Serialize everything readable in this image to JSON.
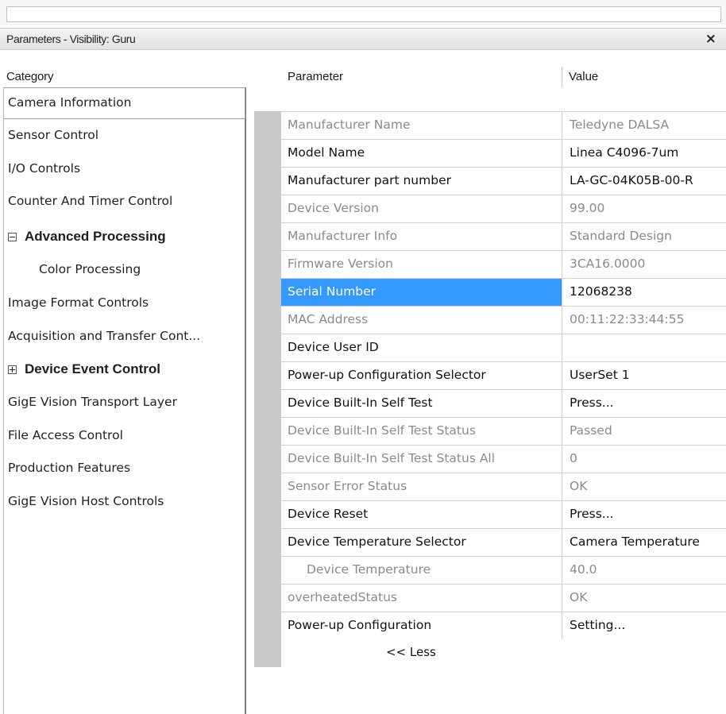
{
  "window": {
    "title": "Parameters - Visibility: Guru",
    "close_glyph": "×"
  },
  "header": {
    "category": "Category",
    "parameter": "Parameter",
    "value": "Value"
  },
  "categories": [
    {
      "label": "Camera Information",
      "selected": true
    },
    {
      "label": "Sensor Control"
    },
    {
      "label": "I/O Controls"
    },
    {
      "label": "Counter And Timer Control"
    },
    {
      "label": "Advanced Processing",
      "expander": "minus",
      "bold": true
    },
    {
      "label": "Color Processing",
      "sub": true
    },
    {
      "label": "Image Format Controls"
    },
    {
      "label": "Acquisition and Transfer Cont..."
    },
    {
      "label": "Device Event Control",
      "expander": "plus",
      "bold": true
    },
    {
      "label": "GigE Vision Transport Layer"
    },
    {
      "label": "File Access Control"
    },
    {
      "label": "Production Features"
    },
    {
      "label": "GigE Vision Host Controls"
    }
  ],
  "parameters": [
    {
      "name": "Manufacturer Name",
      "value": "Teledyne DALSA",
      "enabled": false
    },
    {
      "name": "Model Name",
      "value": "Linea C4096-7um",
      "enabled": true
    },
    {
      "name": "Manufacturer part number",
      "value": "LA-GC-04K05B-00-R",
      "enabled": true
    },
    {
      "name": "Device Version",
      "value": "99.00",
      "enabled": false
    },
    {
      "name": "Manufacturer Info",
      "value": "Standard Design",
      "enabled": false
    },
    {
      "name": "Firmware Version",
      "value": "3CA16.0000",
      "enabled": false
    },
    {
      "name": "Serial Number",
      "value": "12068238",
      "enabled": true,
      "selected": true
    },
    {
      "name": "MAC Address",
      "value": "00:11:22:33:44:55",
      "enabled": false
    },
    {
      "name": "Device User ID",
      "value": "",
      "enabled": true
    },
    {
      "name": "Power-up Configuration Selector",
      "value": "UserSet 1",
      "enabled": true
    },
    {
      "name": "Device Built-In Self Test",
      "value": "Press...",
      "enabled": true
    },
    {
      "name": "Device Built-In Self Test Status",
      "value": "Passed",
      "enabled": false
    },
    {
      "name": "Device Built-In Self Test Status All",
      "value": "0",
      "enabled": false
    },
    {
      "name": "Sensor Error Status",
      "value": "OK",
      "enabled": false
    },
    {
      "name": "Device Reset",
      "value": "Press...",
      "enabled": true
    },
    {
      "name": "Device Temperature Selector",
      "value": "Camera Temperature",
      "enabled": true
    },
    {
      "name": "Device Temperature",
      "value": "40.0",
      "enabled": false,
      "indent": true
    },
    {
      "name": "overheatedStatus",
      "value": "OK",
      "enabled": false
    },
    {
      "name": "Power-up Configuration",
      "value": "Setting...",
      "enabled": true
    }
  ],
  "less_label": "<< Less",
  "colors": {
    "selection": "#3399ff",
    "disabled_text": "#8a8a8a",
    "gutter": "#c9c9c9"
  }
}
